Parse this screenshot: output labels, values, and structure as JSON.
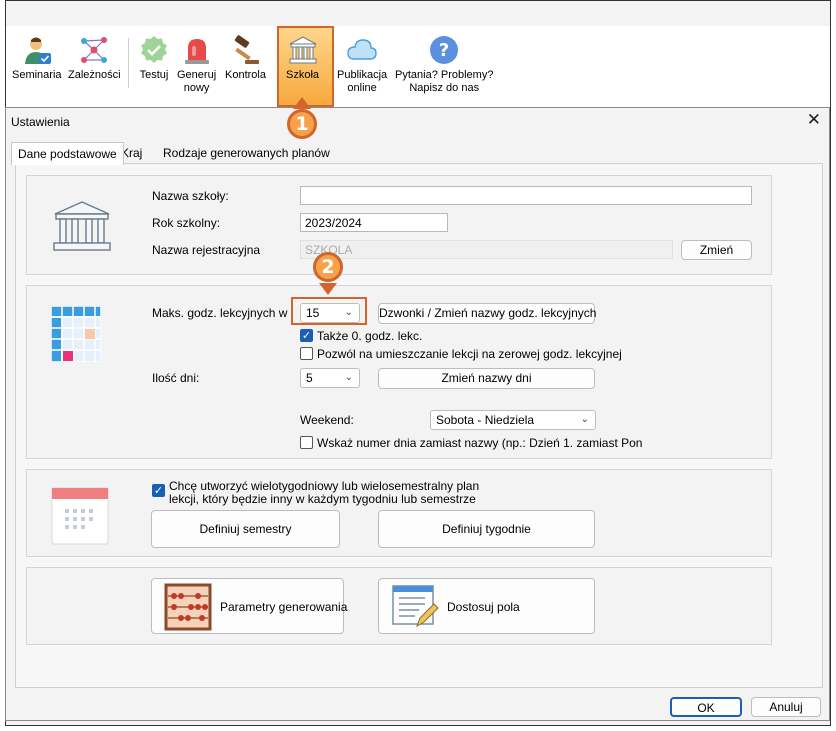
{
  "toolbar": {
    "seminaria": "Seminaria",
    "zaleznosci": "Zależności",
    "testuj": "Testuj",
    "generuj_line1": "Generuj",
    "generuj_line2": "nowy",
    "kontrola": "Kontrola",
    "szkola": "Szkoła",
    "publikacja_line1": "Publikacja",
    "publikacja_line2": "online",
    "pytania_line1": "Pytania? Problemy?",
    "pytania_line2": "Napisz do nas"
  },
  "dialog": {
    "title": "Ustawienia",
    "close": "✕",
    "tabs": [
      "Dane podstawowe",
      "Kraj",
      "Rodzaje generowanych planów"
    ]
  },
  "school": {
    "name_label": "Nazwa szkoły:",
    "name_value": "",
    "year_label": "Rok szkolny:",
    "year_value": "2023/2024",
    "reg_label": "Nazwa rejestracyjna",
    "reg_value": "SZKOLA",
    "change_button": "Zmień"
  },
  "hours": {
    "max_label": "Maks. godz. lekcyjnych w",
    "max_value": "15",
    "bells_button": "Dzwonki / Zmień nazwy godz. lekcyjnych",
    "also_zero": "Także 0. godz. lekc.",
    "allow_zero": "Pozwól na umieszczanie lekcji na zerowej godz. lekcyjnej",
    "days_label": "Ilość dni:",
    "days_value": "5",
    "rename_days_button": "Zmień nazwy dni",
    "weekend_label": "Weekend:",
    "weekend_value": "Sobota - Niedziela",
    "show_day_number": "Wskaż numer dnia zamiast nazwy (np.: Dzień 1. zamiast Pon"
  },
  "multiweek": {
    "checkbox_line1": "Chcę utworzyć wielotygodniowy lub wielosemestralny plan",
    "checkbox_line2": "lekcji, który będzie inny w każdym tygodniu lub semestrze",
    "define_semesters": "Definiuj semestry",
    "define_weeks": "Definiuj tygodnie"
  },
  "tools": {
    "params_button": "Parametry generowania",
    "fields_button": "Dostosuj pola"
  },
  "footer": {
    "ok": "OK",
    "cancel": "Anuluj"
  },
  "annotations": {
    "step1": "1",
    "step2": "2"
  },
  "colors": {
    "highlight_orange": "#d0652d",
    "accent_blue": "#1a5fb4"
  }
}
